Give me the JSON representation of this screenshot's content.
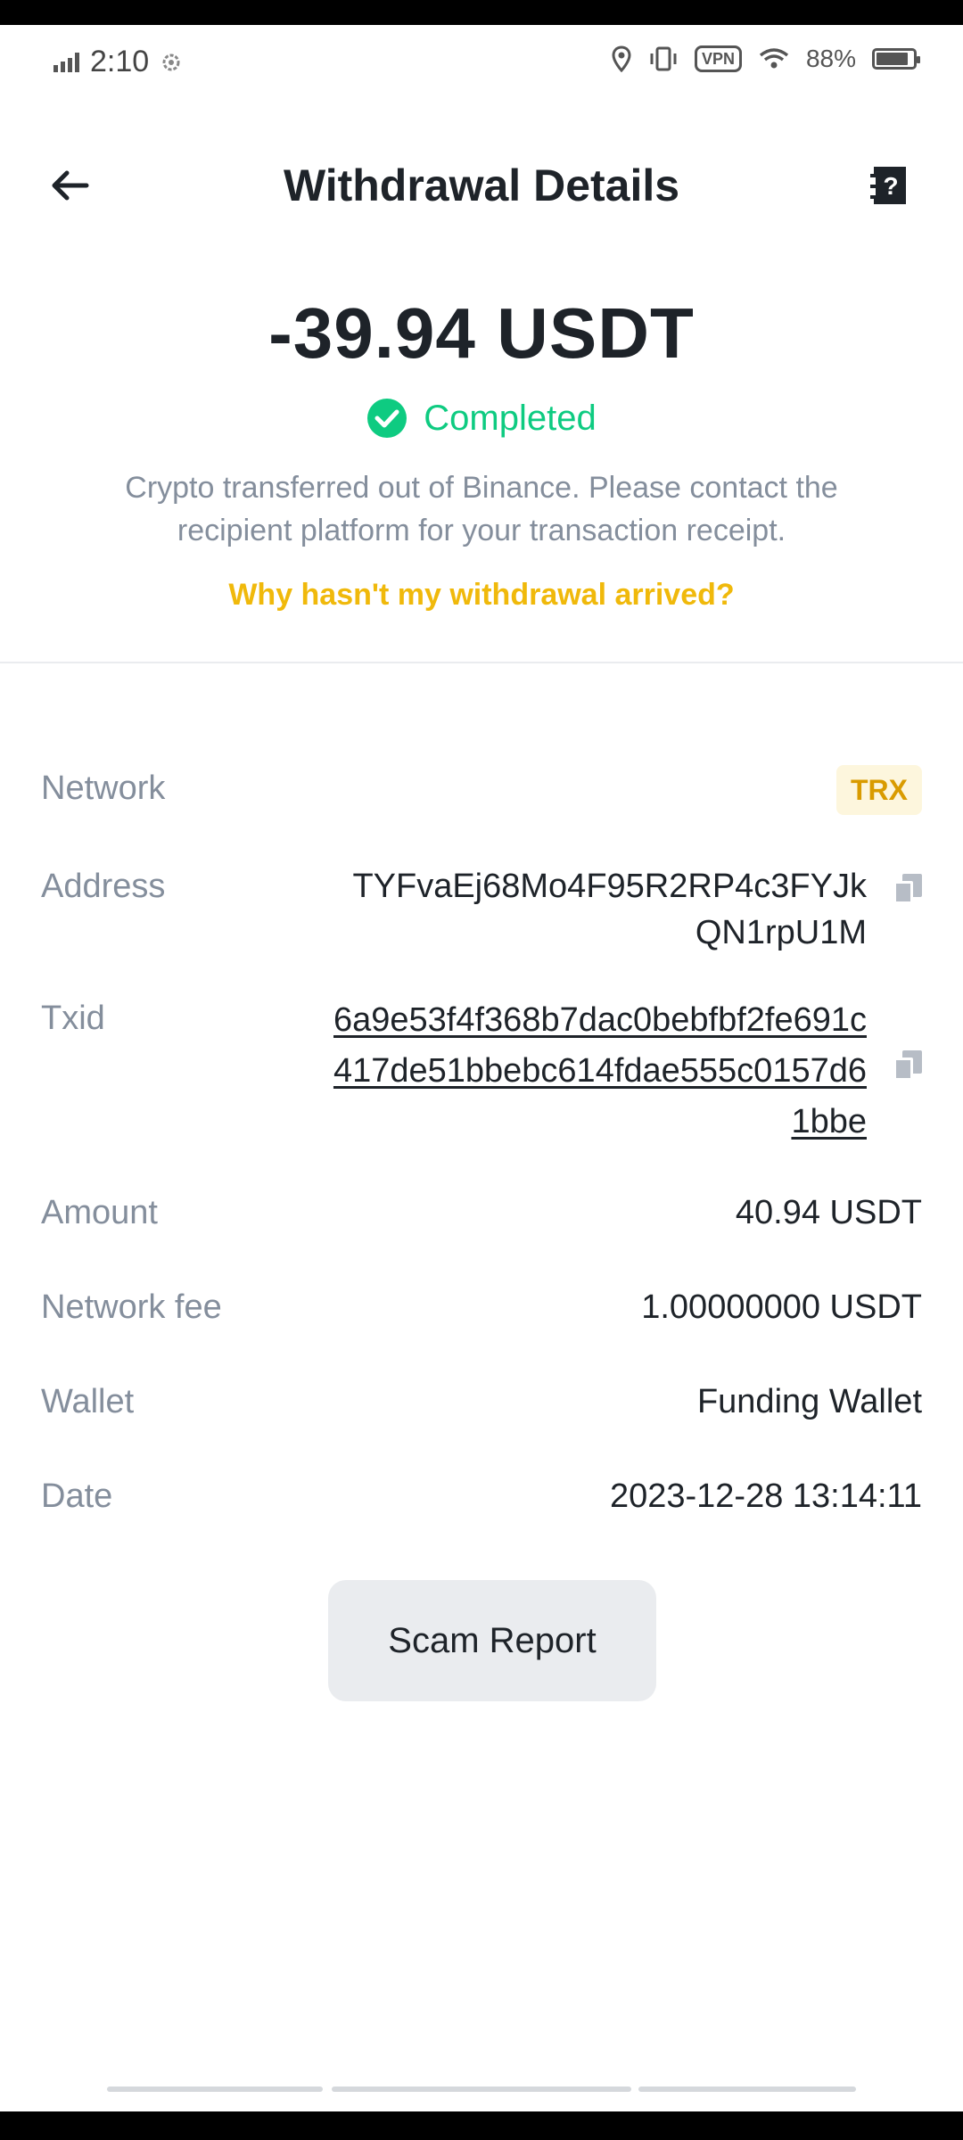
{
  "status_bar": {
    "time": "2:10",
    "vpn_label": "VPN",
    "battery_text": "88%",
    "battery_level": 0.88,
    "icons": [
      "signal-icon",
      "settings-icon",
      "location-icon",
      "vibrate-icon",
      "wifi-icon",
      "battery-icon"
    ]
  },
  "header": {
    "title": "Withdrawal Details",
    "back_icon": "arrow-left-icon",
    "help_icon": "help-document-icon"
  },
  "summary": {
    "amount": "-39.94 USDT",
    "status": "Completed",
    "status_color": "#0ecb81",
    "description": "Crypto transferred out of Binance. Please contact the recipient platform for your transaction receipt.",
    "help_link": "Why hasn't my withdrawal arrived?",
    "link_color": "#f0b90b"
  },
  "details": {
    "network": {
      "label": "Network",
      "value": "TRX"
    },
    "address": {
      "label": "Address",
      "value": "TYFvaEj68Mo4F95R2RP4c3FYJkQN1rpU1M"
    },
    "txid": {
      "label": "Txid",
      "value": "6a9e53f4f368b7dac0bebfbf2fe691c417de51bbebc614fdae555c0157d61bbe"
    },
    "amount": {
      "label": "Amount",
      "value": "40.94 USDT"
    },
    "fee": {
      "label": "Network fee",
      "value": "1.00000000 USDT"
    },
    "wallet": {
      "label": "Wallet",
      "value": "Funding Wallet"
    },
    "date": {
      "label": "Date",
      "value": "2023-12-28 13:14:11"
    }
  },
  "actions": {
    "scam_report": "Scam Report"
  }
}
